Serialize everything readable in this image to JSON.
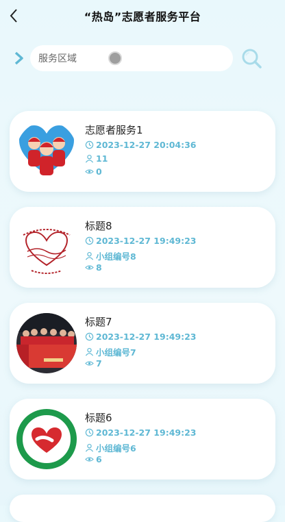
{
  "header": {
    "title": "“热岛”志愿者服务平台"
  },
  "search": {
    "placeholder": "服务区域",
    "button_icon": "search-icon"
  },
  "colors": {
    "accent": "#5fb8d4",
    "background": "#eaf8fc"
  },
  "items": [
    {
      "title": "志愿者服务1",
      "time": "2023-12-27 20:04:36",
      "group": "11",
      "views": "0",
      "image": "volunteer-heart-figures"
    },
    {
      "title": "标题8",
      "time": "2023-12-27 19:49:23",
      "group": "小组编号8",
      "views": "8",
      "image": "volunteer-calligraphy-logo"
    },
    {
      "title": "标题7",
      "time": "2023-12-27 19:49:23",
      "group": "小组编号7",
      "views": "7",
      "image": "group-photo-red-banner"
    },
    {
      "title": "标题6",
      "time": "2023-12-27 19:49:23",
      "group": "小组编号6",
      "views": "6",
      "image": "green-circular-badge"
    }
  ]
}
